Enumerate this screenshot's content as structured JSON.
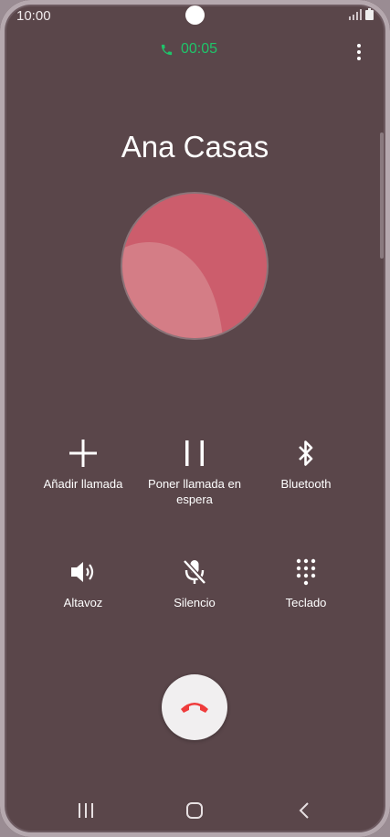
{
  "status_bar": {
    "time": "10:00",
    "icons": [
      "camera-cutout",
      "signal-icon",
      "battery-icon"
    ]
  },
  "call": {
    "duration": "00:05",
    "contact_name": "Ana Casas",
    "accent_color": "#1fc46a",
    "end_call_color": "#ef3b3b"
  },
  "actions": [
    {
      "icon": "plus-icon",
      "label": "Añadir llamada"
    },
    {
      "icon": "pause-icon",
      "label": "Poner llamada en espera"
    },
    {
      "icon": "bluetooth-icon",
      "label": "Bluetooth"
    },
    {
      "icon": "speaker-icon",
      "label": "Altavoz"
    },
    {
      "icon": "mic-off-icon",
      "label": "Silencio"
    },
    {
      "icon": "keypad-icon",
      "label": "Teclado"
    }
  ],
  "navigation": [
    "recent-apps-icon",
    "home-icon",
    "back-icon"
  ]
}
